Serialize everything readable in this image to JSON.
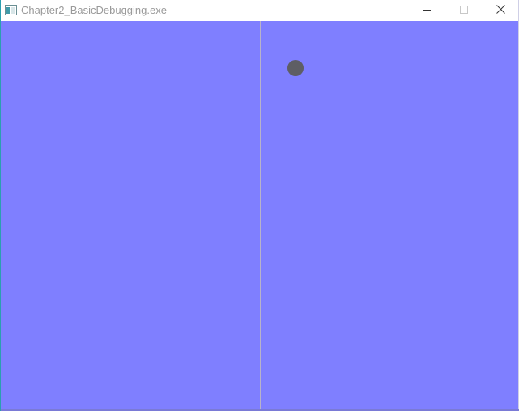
{
  "window": {
    "title": "Chapter2_BasicDebugging.exe",
    "icon": "app-window-icon",
    "controls": {
      "minimize": "minimize-icon",
      "maximize": "maximize-icon",
      "close": "close-icon"
    }
  },
  "canvas": {
    "background_color": "#7f7fff",
    "divider_color": "#b8b3c9",
    "ball_color": "#5e5e64"
  }
}
